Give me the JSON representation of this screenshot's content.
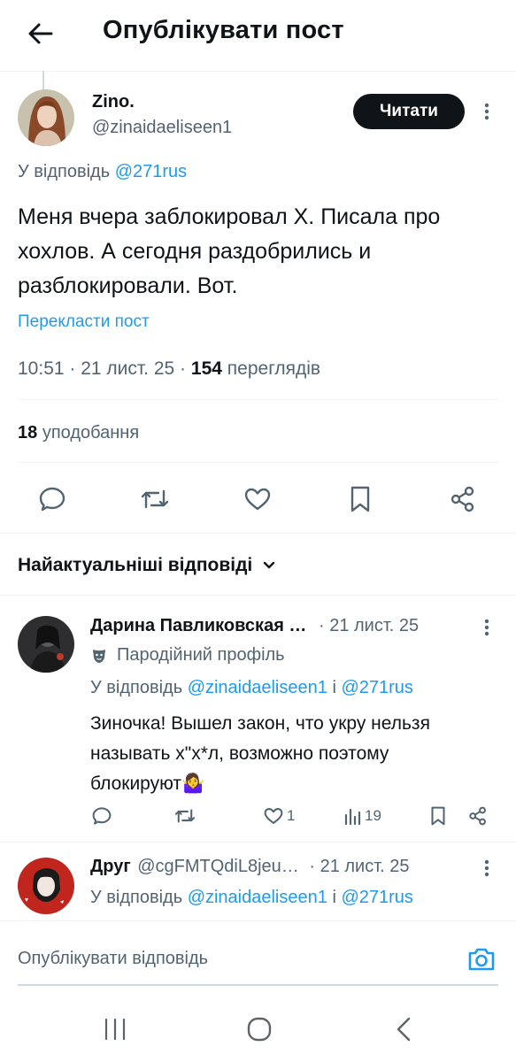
{
  "header": {
    "title": "Опублікувати пост"
  },
  "post": {
    "author_name": "Zino.",
    "handle": "@zinaidaeliseen1",
    "follow_label": "Читати",
    "reply_prefix": "У відповідь",
    "reply_to": "@271rus",
    "text": "Меня вчера заблокировал Х. Писала про хохлов. А сегодня раздобрились и разблокировали. Вот.",
    "translate": "Перекласти пост",
    "time": "10:51 · 21 лист. 25 ·",
    "views_count": "154",
    "views_label": "переглядів",
    "likes_count": "18",
    "likes_label": "уподобання"
  },
  "replies_section": {
    "sort_label": "Найактуальніші відповіді"
  },
  "reply1": {
    "author_name": "Дарина Павликовская …",
    "date": "· 21 лист. 25",
    "badge": "Пародійний профіль",
    "reply_prefix": "У відповідь",
    "reply_to_1": "@zinaidaeliseen1",
    "joiner": "і",
    "reply_to_2": "@271rus",
    "text_line1": "Зиночка! Вышел закон, что укру нельзя",
    "text_line2": "называть х\"х*л, возможно поэтому",
    "text_line3": "блокируют🤷‍♀️",
    "likes": "1",
    "views": "19"
  },
  "reply2": {
    "author_name": "Друг",
    "handle": "@cgFMTQdiL8jeu…",
    "date": "· 21 лист. 25",
    "reply_prefix": "У відповідь",
    "reply_to_1": "@zinaidaeliseen1",
    "joiner": "і",
    "reply_to_2": "@271rus"
  },
  "compose": {
    "placeholder": "Опублікувати відповідь"
  },
  "colors": {
    "accent": "#1d9bf0",
    "text": "#0f1419",
    "muted": "#536471",
    "divider": "#eff3f4"
  }
}
